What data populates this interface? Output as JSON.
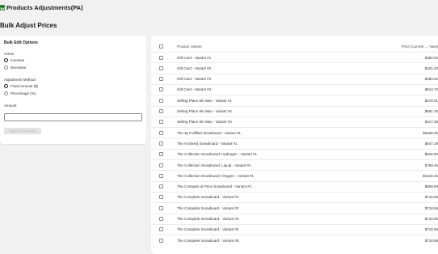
{
  "app": {
    "title": "Products Adjustments(PA)",
    "icon": "app-checkmark-icon"
  },
  "page": {
    "title": "Bulk Adjust Prices"
  },
  "options": {
    "title": "Bulk Edit Options",
    "action_label": "Action",
    "action_options": [
      "Increase",
      "Decrease"
    ],
    "action_selected": "Increase",
    "method_label": "Adjustment Method",
    "method_options": [
      "Fixed Amount ($)",
      "Percentage (%)"
    ],
    "method_selected": "Fixed Amount ($)",
    "amount_label": "Amount",
    "amount_value": "",
    "apply_label": "Apply to 0 products"
  },
  "table": {
    "col_variant": "Product Variant",
    "col_price": "Price (Current → New)",
    "rows": [
      {
        "name": "Gift Card - Variant #1",
        "price": "$382.92"
      },
      {
        "name": "Gift Card - Variant #2",
        "price": "$421.40"
      },
      {
        "name": "Gift Card - Variant #3",
        "price": "$483.52"
      },
      {
        "name": "Gift Card - Variant #4",
        "price": "$613.72"
      },
      {
        "name": "Selling Plans Ski Wax - Variant #1",
        "price": "$478.01"
      },
      {
        "name": "Selling Plans Ski Wax - Variant #2",
        "price": "$581.76"
      },
      {
        "name": "Selling Plans Ski Wax - Variant #3",
        "price": "$417.39"
      },
      {
        "name": "The 3p Fulfilled Snowboard - Variant #1",
        "price": "$5409.35"
      },
      {
        "name": "The Archived Snowboard - Variant #1",
        "price": "$647.29"
      },
      {
        "name": "The Collection Snowboard: Hydrogen - Variant #1",
        "price": "$816.80"
      },
      {
        "name": "The Collection Snowboard: Liquid - Variant #1",
        "price": "$769.45"
      },
      {
        "name": "The Collection Snowboard: Oxygen - Variant #1",
        "price": "$1049.45"
      },
      {
        "name": "The Compare at Price Snowboard - Variant #1",
        "price": "$809.59"
      },
      {
        "name": "The Complete Snowboard - Variant #1",
        "price": "$718.56"
      },
      {
        "name": "The Complete Snowboard - Variant #2",
        "price": "$718.56"
      },
      {
        "name": "The Complete Snowboard - Variant #3",
        "price": "$718.56"
      },
      {
        "name": "The Complete Snowboard - Variant #4",
        "price": "$718.56"
      },
      {
        "name": "The Complete Snowboard - Variant #5",
        "price": "$718.56"
      }
    ]
  }
}
